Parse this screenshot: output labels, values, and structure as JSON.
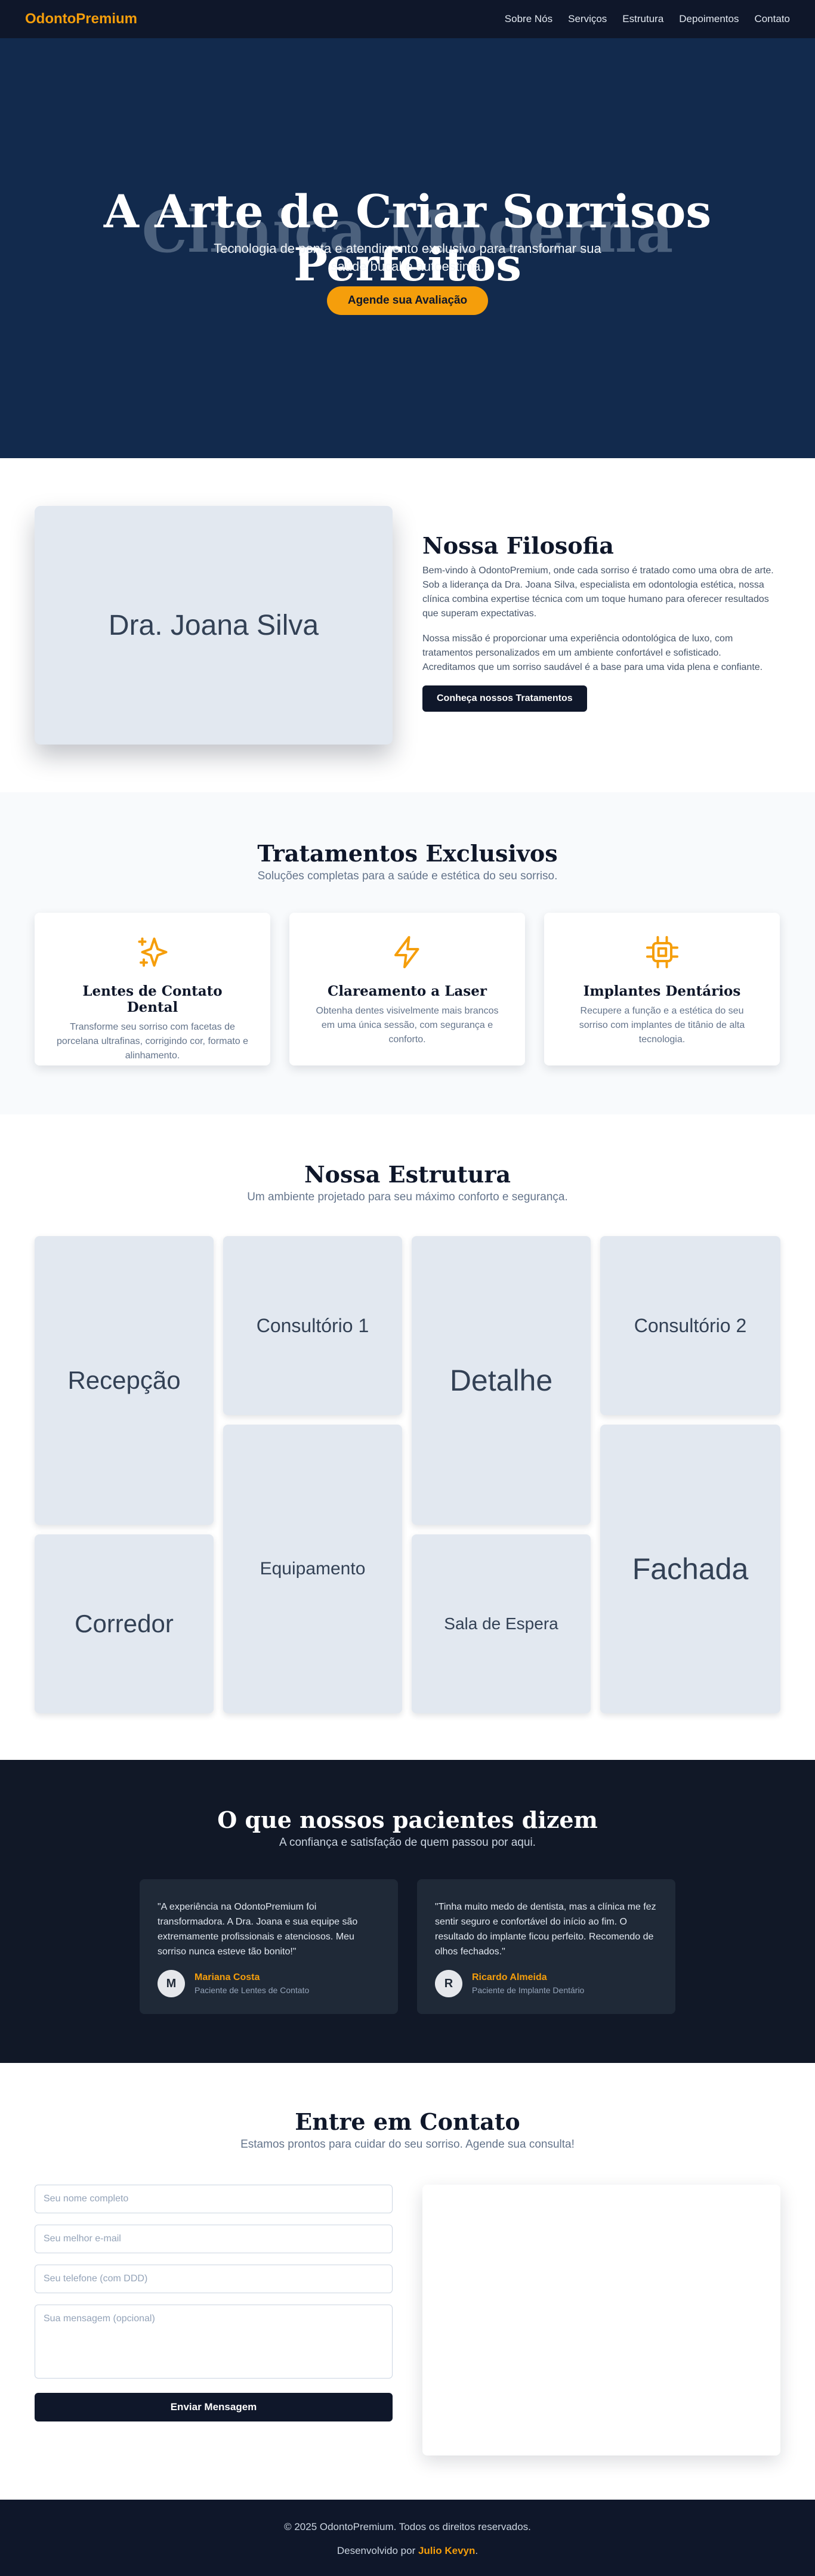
{
  "nav": {
    "logo": "OdontoPremium",
    "links": [
      "Sobre Nós",
      "Serviços",
      "Estrutura",
      "Depoimentos",
      "Contato"
    ]
  },
  "hero": {
    "ghost_text": "Clínica Moderna",
    "title": "A Arte de Criar Sorrisos Perfeitos",
    "subtitle": "Tecnologia de ponta e atendimento exclusivo para transformar sua saúde bucal e autoestima.",
    "cta": "Agende sua Avaliação"
  },
  "about": {
    "photo_label": "Dra. Joana Silva",
    "title": "Nossa Filosofia",
    "p1": "Bem-vindo à OdontoPremium, onde cada sorriso é tratado como uma obra de arte. Sob a liderança da Dra. Joana Silva, especialista em odontologia estética, nossa clínica combina expertise técnica com um toque humano para oferecer resultados que superam expectativas.",
    "p2": "Nossa missão é proporcionar uma experiência odontológica de luxo, com tratamentos personalizados em um ambiente confortável e sofisticado. Acreditamos que um sorriso saudável é a base para uma vida plena e confiante.",
    "cta": "Conheça nossos Tratamentos"
  },
  "treatments": {
    "title": "Tratamentos Exclusivos",
    "subtitle": "Soluções completas para a saúde e estética do seu sorriso.",
    "items": [
      {
        "icon": "sparkles-icon",
        "title": "Lentes de Contato Dental",
        "text": "Transforme seu sorriso com facetas de porcelana ultrafinas, corrigindo cor, formato e alinhamento."
      },
      {
        "icon": "lightning-icon",
        "title": "Clareamento a Laser",
        "text": "Obtenha dentes visivelmente mais brancos em uma única sessão, com segurança e conforto."
      },
      {
        "icon": "chip-icon",
        "title": "Implantes Dentários",
        "text": "Recupere a função e a estética do seu sorriso com implantes de titânio de alta tecnologia."
      }
    ],
    "accent": "#f59e0b"
  },
  "structure": {
    "title": "Nossa Estrutura",
    "subtitle": "Um ambiente projetado para seu máximo conforto e segurança.",
    "tiles": [
      "Recepção",
      "Consultório 1",
      "Detalhe",
      "Consultório 2",
      "Equipamento",
      "Fachada",
      "Corredor",
      "Sala de Espera"
    ]
  },
  "testimonials": {
    "title": "O que nossos pacientes dizem",
    "subtitle": "A confiança e satisfação de quem passou por aqui.",
    "items": [
      {
        "quote": "\"A experiência na OdontoPremium foi transformadora. A Dra. Joana e sua equipe são extremamente profissionais e atenciosos. Meu sorriso nunca esteve tão bonito!\"",
        "initial": "M",
        "name": "Mariana Costa",
        "role": "Paciente de Lentes de Contato"
      },
      {
        "quote": "\"Tinha muito medo de dentista, mas a clínica me fez sentir seguro e confortável do início ao fim. O resultado do implante ficou perfeito. Recomendo de olhos fechados.\"",
        "initial": "R",
        "name": "Ricardo Almeida",
        "role": "Paciente de Implante Dentário"
      }
    ]
  },
  "contact": {
    "title": "Entre em Contato",
    "subtitle": "Estamos prontos para cuidar do seu sorriso. Agende sua consulta!",
    "name_placeholder": "Seu nome completo",
    "email_placeholder": "Seu melhor e-mail",
    "phone_placeholder": "Seu telefone (com DDD)",
    "message_placeholder": "Sua mensagem (opcional)",
    "submit": "Enviar Mensagem"
  },
  "footer": {
    "copyright": "© 2025 OdontoPremium. Todos os direitos reservados.",
    "credit_prefix": "Desenvolvido por ",
    "author": "Julio Kevyn",
    "credit_suffix": "."
  }
}
